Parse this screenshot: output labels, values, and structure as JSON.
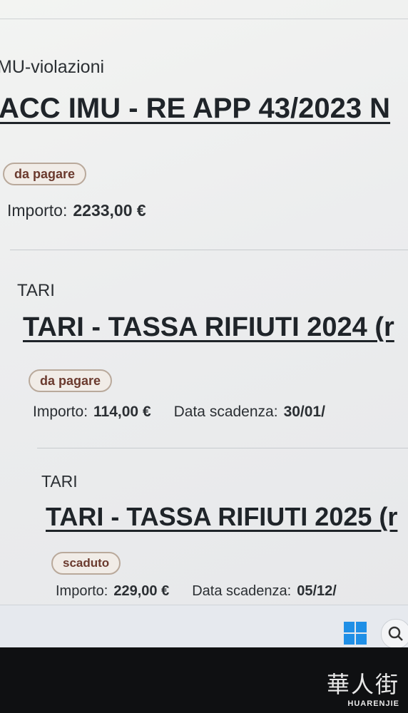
{
  "items": [
    {
      "category": "MU-violazioni",
      "title": "ACC IMU - RE APP 43/2023 N",
      "status": "da pagare",
      "amount_label": "Importo:",
      "amount": "2233,00 €"
    },
    {
      "category": "TARI",
      "title": "TARI - TASSA RIFIUTI 2024 (r",
      "status": "da pagare",
      "amount_label": "Importo:",
      "amount": "114,00 €",
      "due_label": "Data scadenza:",
      "due": "30/01/"
    },
    {
      "category": "TARI",
      "title": "TARI - TASSA RIFIUTI 2025 (r",
      "status": "scaduto",
      "amount_label": "Importo:",
      "amount": "229,00 €",
      "due_label": "Data scadenza:",
      "due": "05/12/"
    }
  ],
  "taskbar": {
    "start_icon": "windows-start-icon",
    "search_icon": "search-icon"
  },
  "watermark": {
    "cn": "華人街",
    "en": "HUARENJIE"
  },
  "colors": {
    "status_accent": "#6b3a2e",
    "windows_blue": "#1f8fe6"
  }
}
